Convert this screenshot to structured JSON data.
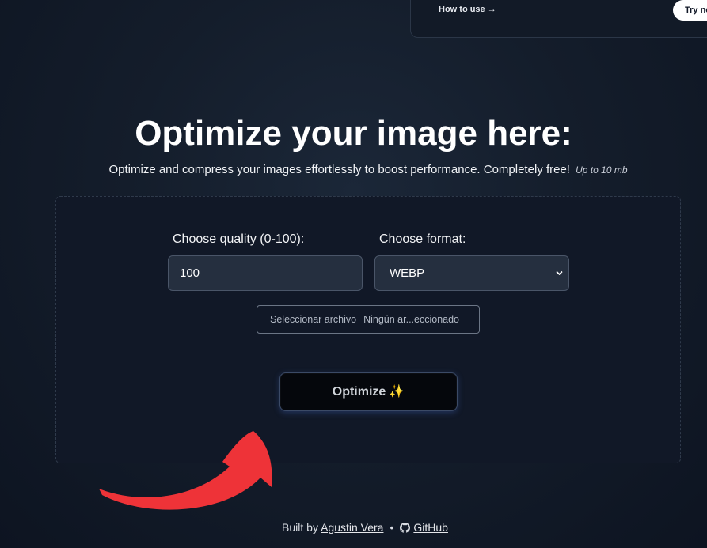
{
  "banner": {
    "link_label": "How to use →",
    "button_label": "Try now"
  },
  "hero": {
    "title": "Optimize your image here:",
    "subtitle": "Optimize and compress your images effortlessly to boost performance. Completely free!",
    "limit_note": "Up to 10 mb"
  },
  "form": {
    "quality_label": "Choose quality (0-100):",
    "quality_value": "100",
    "format_label": "Choose format:",
    "format_selected": "WEBP",
    "file_button_label": "Seleccionar archivo",
    "file_status": "Ningún ar...eccionado",
    "submit_label": "Optimize",
    "submit_emoji": "✨"
  },
  "footer": {
    "built_by_prefix": "Built by",
    "author": "Agustin Vera",
    "github_label": "GitHub"
  },
  "colors": {
    "background": "#141d2b",
    "panel": "#111827",
    "arrow": "#ee3338",
    "sparkle": "#f5c542"
  },
  "icons": {
    "select_caret": "chevron-down-icon",
    "github": "github-icon"
  }
}
